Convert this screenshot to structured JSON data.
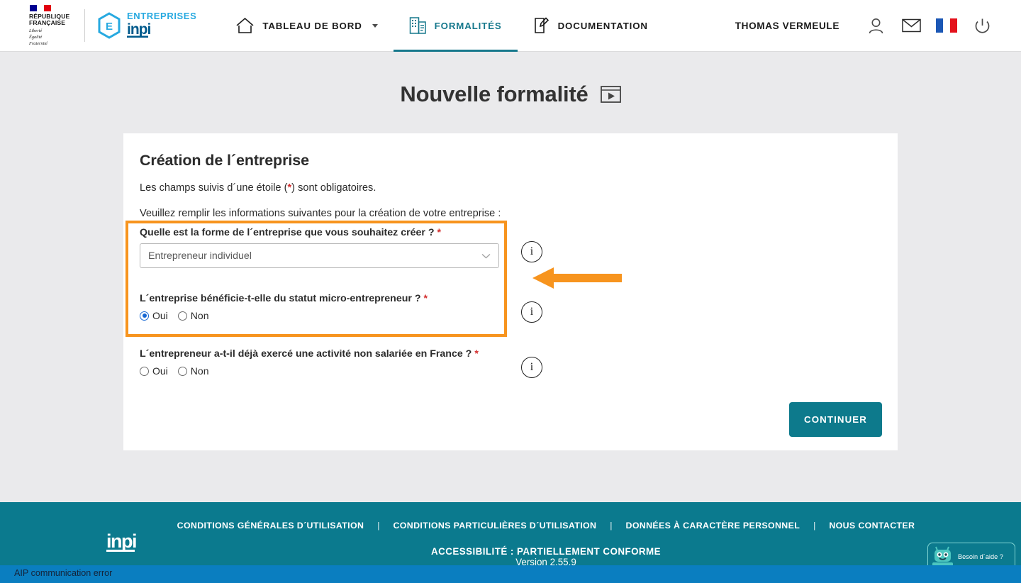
{
  "header": {
    "republic": {
      "line1": "RÉPUBLIQUE",
      "line2": "FRANÇAISE",
      "devise1": "Liberté",
      "devise2": "Égalité",
      "devise3": "Fraternité"
    },
    "brand": {
      "top": "ENTREPRISES",
      "bottom": "inpi",
      "hex_letter": "E",
      "accent_color": "#27a9e0"
    },
    "nav": [
      {
        "label": "TABLEAU DE BORD",
        "icon": "home-icon",
        "active": false,
        "has_caret": true
      },
      {
        "label": "FORMALITÉS",
        "icon": "building-document-icon",
        "active": true,
        "has_caret": false
      },
      {
        "label": "DOCUMENTATION",
        "icon": "document-pen-icon",
        "active": false,
        "has_caret": false
      }
    ],
    "user_name": "THOMAS VERMEULE",
    "icons": [
      "user-icon",
      "mail-icon",
      "french-flag-icon",
      "power-icon"
    ],
    "active_color": "#16788c"
  },
  "page": {
    "title": "Nouvelle formalité",
    "title_icon": "video-tutorial-icon"
  },
  "card": {
    "title": "Création de l´entreprise",
    "lede_before": "Les champs suivis d´une étoile (",
    "lede_star": "*",
    "lede_after": ") sont obligatoires.",
    "lede2": "Veuillez remplir les informations suivantes pour la création de votre entreprise :",
    "questions": [
      {
        "label": "Quelle est la forme de l´entreprise que vous souhaitez créer ?",
        "required_mark": "*",
        "type": "select",
        "value": "Entrepreneur individuel",
        "info_icon": "info-icon"
      },
      {
        "label": "L´entreprise bénéficie-t-elle du statut micro-entrepreneur ?",
        "required_mark": "*",
        "type": "radio",
        "options": [
          "Oui",
          "Non"
        ],
        "selected": "Oui",
        "info_icon": "info-icon"
      },
      {
        "label": "L´entrepreneur a-t-il déjà exercé une activité non salariée en France ?",
        "required_mark": "*",
        "type": "radio",
        "options": [
          "Oui",
          "Non"
        ],
        "selected": null,
        "info_icon": "info-icon"
      }
    ],
    "continue_label": "CONTINUER",
    "highlight_color": "#f7941e",
    "annotation": {
      "type": "arrow-left",
      "color": "#f7941e"
    }
  },
  "footer": {
    "logo": "inpi",
    "links": [
      "CONDITIONS GÉNÉRALES D´UTILISATION",
      "CONDITIONS PARTICULIÈRES D´UTILISATION",
      "DONNÉES À CARACTÈRE PERSONNEL",
      "NOUS CONTACTER"
    ],
    "separator": "|",
    "accessibility": "ACCESSIBILITÉ : PARTIELLEMENT CONFORME",
    "version": "Version 2.55.9",
    "background_color": "#0b7a8e"
  },
  "chatbot": {
    "label": "Besoin d´aide ?",
    "icon": "robot-icon"
  },
  "statusbar": {
    "message": "AIP communication error",
    "background_color": "#0a7ec0"
  }
}
